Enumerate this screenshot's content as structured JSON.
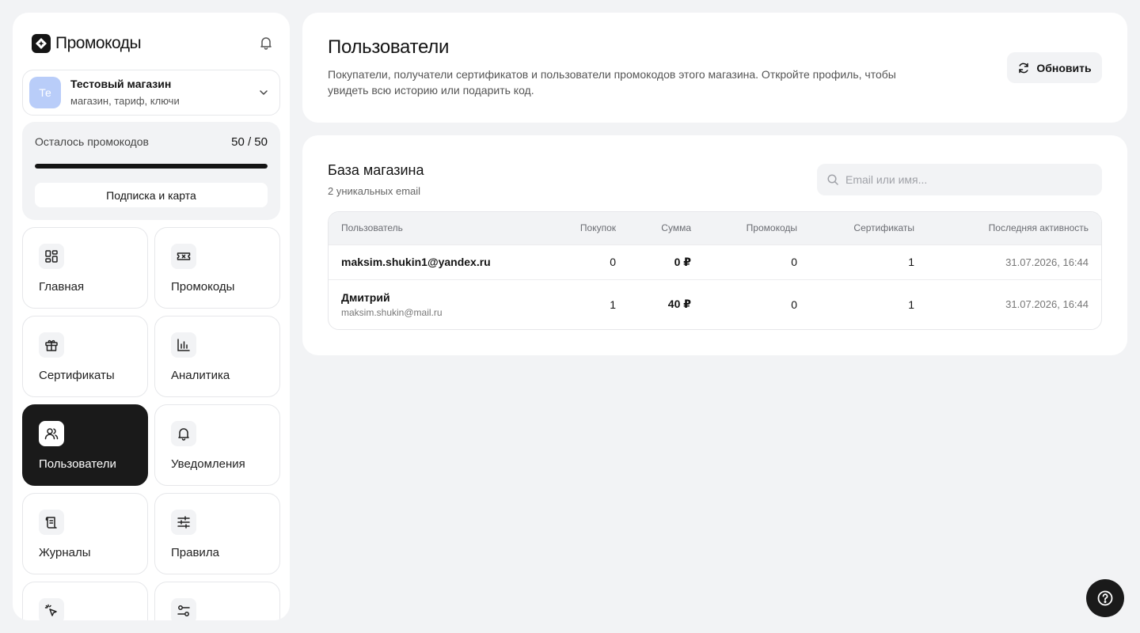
{
  "app": {
    "brand": "Промокоды",
    "icons": {
      "logo": "diamond-spark-icon",
      "notifications": "bell-icon"
    }
  },
  "store": {
    "avatar_initials": "Те",
    "name": "Тестовый магазин",
    "subtitle": "магазин, тариф, ключи",
    "avatar_color": "#b9cdf9"
  },
  "quota": {
    "label": "Осталось промокодов",
    "value": "50 / 50",
    "fraction": 1.0,
    "button_label": "Подписка и карта"
  },
  "nav": {
    "items": [
      {
        "id": "home",
        "label": "Главная",
        "icon": "dashboard-icon",
        "active": false
      },
      {
        "id": "promocodes",
        "label": "Промокоды",
        "icon": "ticket-icon",
        "active": false
      },
      {
        "id": "certificates",
        "label": "Сертификаты",
        "icon": "gift-icon",
        "active": false
      },
      {
        "id": "analytics",
        "label": "Аналитика",
        "icon": "bar-chart-icon",
        "active": false
      },
      {
        "id": "users",
        "label": "Пользователи",
        "icon": "users-icon",
        "active": true
      },
      {
        "id": "notifications",
        "label": "Уведомления",
        "icon": "bell-icon",
        "active": false
      },
      {
        "id": "logs",
        "label": "Журналы",
        "icon": "scroll-icon",
        "active": false
      },
      {
        "id": "rules",
        "label": "Правила",
        "icon": "sliders-icon",
        "active": false
      },
      {
        "id": "item9",
        "label": "",
        "icon": "pointer-click-icon",
        "active": false
      },
      {
        "id": "item10",
        "label": "",
        "icon": "toggles-icon",
        "active": false
      }
    ]
  },
  "header": {
    "title": "Пользователи",
    "description": "Покупатели, получатели сертификатов и пользователи промокодов этого магазина. Откройте профиль, чтобы увидеть всю историю или подарить код.",
    "refresh_label": "Обновить",
    "refresh_icon": "refresh-icon"
  },
  "base": {
    "title": "База магазина",
    "subtitle": "2 уникальных email",
    "search_placeholder": "Email или имя...",
    "columns": [
      "Пользователь",
      "Покупок",
      "Сумма",
      "Промокоды",
      "Сертификаты",
      "Последняя активность"
    ],
    "rows": [
      {
        "name": "maksim.shukin1@yandex.ru",
        "email": "",
        "purchases": "0",
        "sum": "0 ₽",
        "promocodes": "0",
        "certificates": "1",
        "last_activity": "31.07.2026, 16:44"
      },
      {
        "name": "Дмитрий",
        "email": "maksim.shukin@mail.ru",
        "purchases": "1",
        "sum": "40 ₽",
        "promocodes": "0",
        "certificates": "1",
        "last_activity": "31.07.2026, 16:44"
      }
    ]
  },
  "help": {
    "icon": "help-circle-icon"
  }
}
